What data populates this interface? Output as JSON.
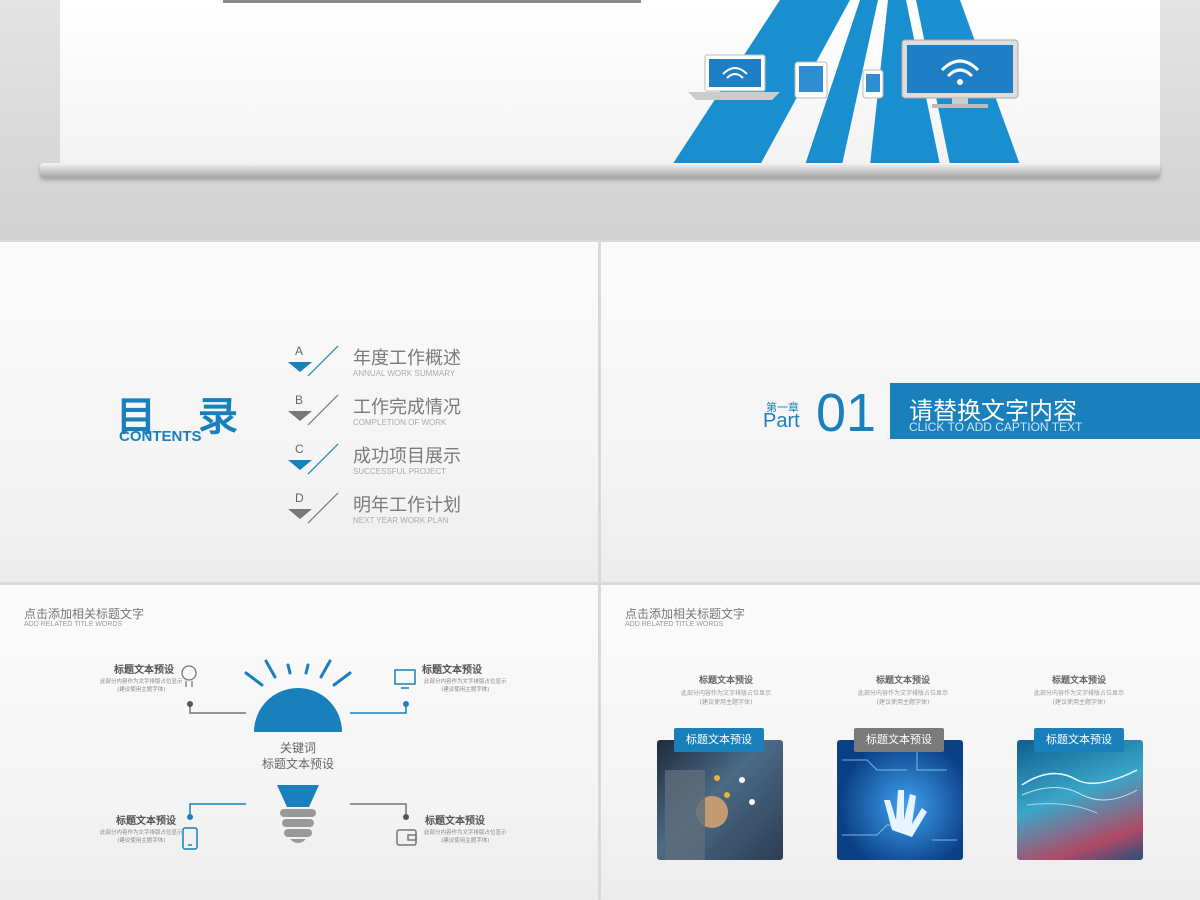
{
  "colors": {
    "accent": "#1a80bb",
    "gray": "#7a7a7a"
  },
  "contents_slide": {
    "heading": "目 录",
    "heading_en": "CONTENTS",
    "items": [
      {
        "letter": "A",
        "title": "年度工作概述",
        "subtitle": "ANNUAL WORK SUMMARY"
      },
      {
        "letter": "B",
        "title": "工作完成情况",
        "subtitle": "COMPLETION OF WORK"
      },
      {
        "letter": "C",
        "title": "成功项目展示",
        "subtitle": "SUCCESSFUL PROJECT"
      },
      {
        "letter": "D",
        "title": "明年工作计划",
        "subtitle": "NEXT YEAR WORK PLAN"
      }
    ]
  },
  "part_slide": {
    "chapter": "第一章",
    "part_word": "Part",
    "part_number": "01",
    "title": "请替换文字内容",
    "subtitle": "CLICK TO ADD CAPTION TEXT"
  },
  "idea_slide": {
    "header": "点击添加相关标题文字",
    "header_en": "ADD RELATED TITLE WORDS",
    "center_line1": "关键词",
    "center_line2": "标题文本预设",
    "nodes": [
      {
        "title": "标题文本预设",
        "desc1": "此部分内容作为文字排版占位显示",
        "desc2": "(建议使用主题字体)",
        "icon": "lightbulb-icon"
      },
      {
        "title": "标题文本预设",
        "desc1": "此部分内容作为文字排版占位显示",
        "desc2": "(建议使用主题字体)",
        "icon": "monitor-icon"
      },
      {
        "title": "标题文本预设",
        "desc1": "此部分内容作为文字排版占位显示",
        "desc2": "(建议使用主题字体)",
        "icon": "phone-icon"
      },
      {
        "title": "标题文本预设",
        "desc1": "此部分内容作为文字排版占位显示",
        "desc2": "(建议使用主题字体)",
        "icon": "wallet-icon"
      }
    ]
  },
  "cards_slide": {
    "header": "点击添加相关标题文字",
    "header_en": "ADD RELATED TITLE WORDS",
    "cards": [
      {
        "heading": "标题文本预设",
        "desc1": "此部分内容作为文字排版占位显示",
        "desc2": "(建议使用主题字体)",
        "tag": "标题文本预设",
        "tag_color": "#1a80bb"
      },
      {
        "heading": "标题文本预设",
        "desc1": "此部分内容作为文字排版占位显示",
        "desc2": "(建议使用主题字体)",
        "tag": "标题文本预设",
        "tag_color": "#7a7a7a"
      },
      {
        "heading": "标题文本预设",
        "desc1": "此部分内容作为文字排版占位显示",
        "desc2": "(建议使用主题字体)",
        "tag": "标题文本预设",
        "tag_color": "#1a80bb"
      }
    ]
  }
}
